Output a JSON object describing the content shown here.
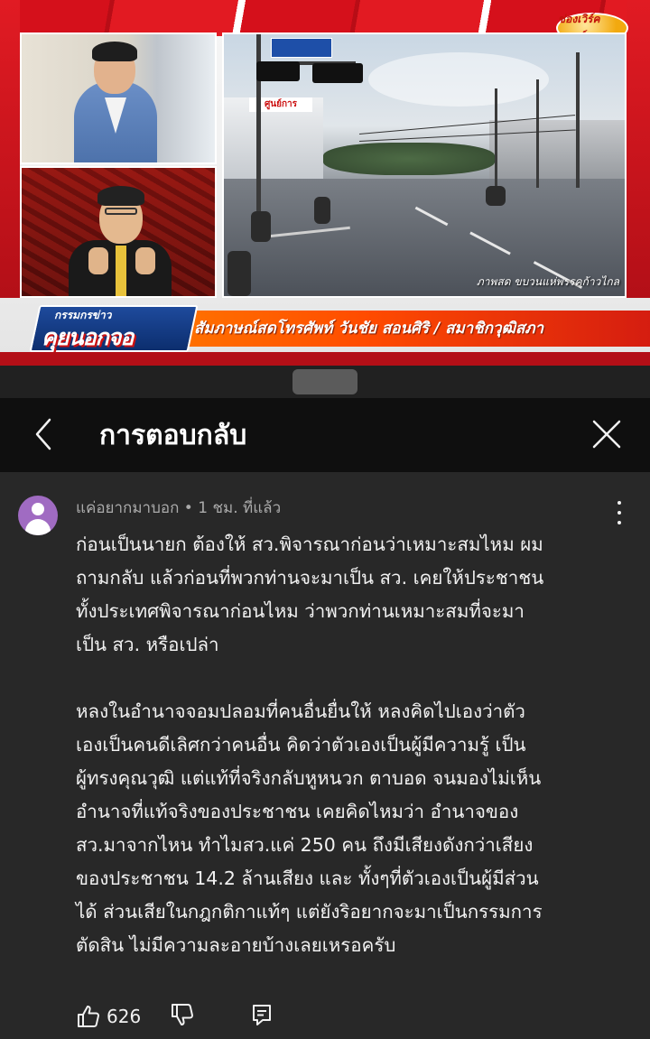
{
  "video": {
    "channel_logo_text": "ช่องเวิร์คพอยท์",
    "building_sign_text": "ศูนย์การ",
    "street_caption": "ภาพสด ขบวนแห่พรรคก้าวไกล",
    "program_logo_top": "กรรมกรข่าว",
    "program_logo_main": "คุยนอกจอ",
    "lower_third_text": "สัมภาษณ์สดโทรศัพท์ วันชัย สอนศิริ / สมาชิกวุฒิสภา"
  },
  "sheet": {
    "title": "การตอบกลับ",
    "back_icon": "chevron-left-icon",
    "close_icon": "close-icon"
  },
  "comment": {
    "author": "แค่อยากมาบอก",
    "separator": "•",
    "time": "1 ชม. ที่แล้ว",
    "paragraph1_lines": [
      "ก่อนเป็นนายก ต้องให้ สว.พิจารณาก่อนว่าเหมาะสมไหม ผม",
      "ถามกลับ แล้วก่อนที่พวกท่านจะมาเป็น สว. เคยให้ประชาชน",
      "ทั้งประเทศพิจารณาก่อนไหม ว่าพวกท่านเหมาะสมที่จะมา",
      "เป็น สว. หรือเปล่า"
    ],
    "paragraph2_lines": [
      "หลงในอำนาจจอมปลอมที่คนอื่นยื่นให้ หลงคิดไปเองว่าตัว",
      "เองเป็นคนดีเลิศกว่าคนอื่น คิดว่าตัวเองเป็นผู้มีความรู้ เป็น",
      "ผู้ทรงคุณวุฒิ แต่แท้ที่จริงกลับหูหนวก ตาบอด จนมองไม่เห็น",
      "อำนาจที่แท้จริงของประชาชน เคยคิดไหมว่า อำนาจของ",
      "สว.มาจากไหน ทำไมสว.แค่ 250 คน ถึงมีเสียงดังกว่าเสียง",
      "ของประชาชน 14.2 ล้านเสียง และ ทั้งๆที่ตัวเองเป็นผู้มีส่วน",
      "ได้ ส่วนเสียในกฎกติกาแท้ๆ แต่ยังริอยากจะมาเป็นกรรมการ",
      "ตัดสิน ไม่มีความละอายบ้างเลยเหรอครับ"
    ],
    "like_count": "626",
    "avatar_color": "#a06bc2"
  }
}
